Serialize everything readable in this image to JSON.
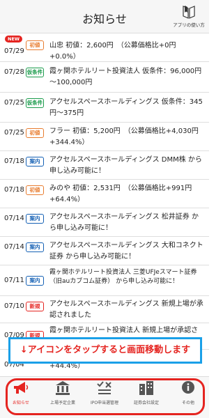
{
  "header": {
    "title": "お知らせ",
    "help_label": "アプリの使い方"
  },
  "colors": {
    "badge_orange": "#e87c2f",
    "badge_green": "#1a9b4b",
    "badge_blue": "#1460b4",
    "badge_red": "#e52420",
    "notice_border": "#1aa0e8",
    "accent": "#e52420"
  },
  "new_label": "NEW",
  "items": [
    {
      "date": "07/29",
      "badge": "初値",
      "text": "山忠 初値：2,600円　（公募価格比+0円　+0.0%）"
    },
    {
      "date": "07/28",
      "badge": "仮条件",
      "text": "霞ヶ関ホテルリート投資法人 仮条件：96,000円～100,000円"
    },
    {
      "date": "07/25",
      "badge": "仮条件",
      "text": "アクセルスペースホールディングス 仮条件：345円～375円"
    },
    {
      "date": "07/25",
      "badge": "初値",
      "text": "フラー 初値：5,200円　（公募価格比+4,030円　+344.4%）"
    },
    {
      "date": "07/18",
      "badge": "案内",
      "text": "アクセルスペースホールディングス DMM株 から申し込み可能に！"
    },
    {
      "date": "07/18",
      "badge": "初値",
      "text": "みのや 初値：2,531円　（公募価格比+991円　+64.4%）"
    },
    {
      "date": "07/14",
      "badge": "案内",
      "text": "アクセルスペースホールディングス 松井証券 から申し込み可能に！"
    },
    {
      "date": "07/14",
      "badge": "案内",
      "text": "アクセルスペースホールディングス 大和コネクト証券 から申し込み可能に！"
    },
    {
      "date": "07/11",
      "badge": "案内",
      "text": "霞ヶ関ホテルリート投資法人 三菱UFJeスマート証券（旧auカブコム証券） から申し込み可能に！"
    },
    {
      "date": "07/10",
      "badge": "新規",
      "text": "アクセルスペースホールディングス 新規上場が承認されました"
    },
    {
      "date": "07/09",
      "badge": "新規",
      "text": "霞ヶ関ホテルリート投資法人 新規上場が承認されました"
    },
    {
      "date": "07/04",
      "badge": "",
      "text": "+44.4%）"
    }
  ],
  "notice": "↓アイコンをタップすると画面移動します",
  "tabs": [
    {
      "label": "お知らせ",
      "icon": "megaphone-icon"
    },
    {
      "label": "上場予定企業",
      "icon": "bank-building-icon"
    },
    {
      "label": "IPO申当選管理",
      "icon": "checklist-icon"
    },
    {
      "label": "証券会社設定",
      "icon": "buildings-icon"
    },
    {
      "label": "その他",
      "icon": "info-icon"
    }
  ]
}
